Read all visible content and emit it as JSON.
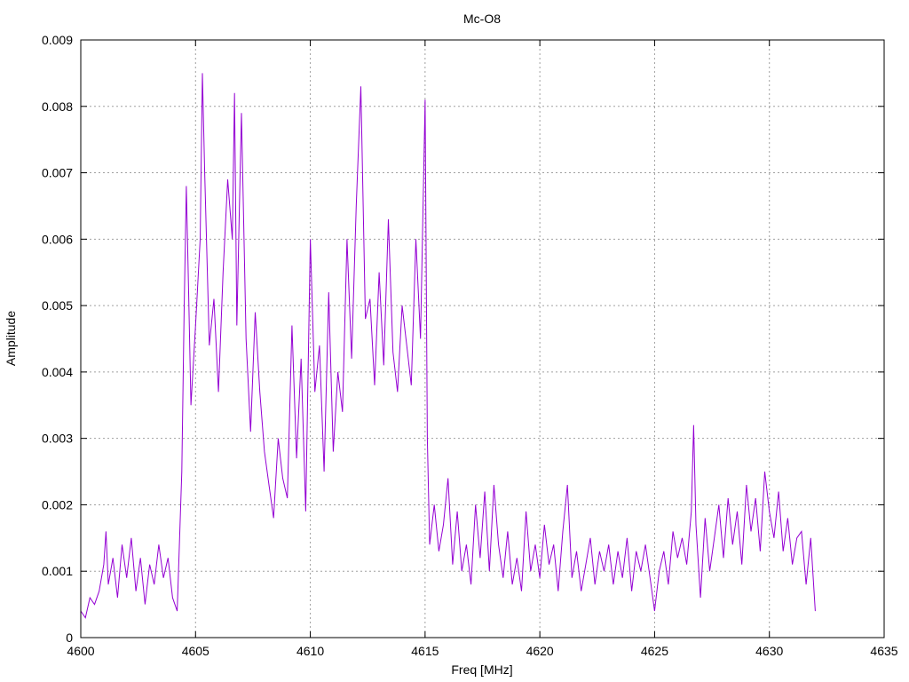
{
  "chart_data": {
    "type": "line",
    "title": "Mc-O8",
    "xlabel": "Freq [MHz]",
    "ylabel": "Amplitude",
    "xlim": [
      4600,
      4635
    ],
    "ylim": [
      0,
      0.009
    ],
    "x_ticks": [
      "4600",
      "4605",
      "4610",
      "4615",
      "4620",
      "4625",
      "4630",
      "4635"
    ],
    "y_ticks": [
      "0",
      "0.001",
      "0.002",
      "0.003",
      "0.004",
      "0.005",
      "0.006",
      "0.007",
      "0.008",
      "0.009"
    ],
    "grid": true,
    "line_color": "#9400d3",
    "series": [
      {
        "x": [
          4600.0,
          4600.2,
          4600.4,
          4600.6,
          4600.8,
          4601.0,
          4601.1,
          4601.2,
          4601.4,
          4601.6,
          4601.8,
          4602.0,
          4602.2,
          4602.4,
          4602.6,
          4602.8,
          4603.0,
          4603.2,
          4603.4,
          4603.6,
          4603.8,
          4604.0,
          4604.2,
          4604.4,
          4604.5,
          4604.6,
          4604.7,
          4604.8,
          4605.0,
          4605.2,
          4605.3,
          4605.4,
          4605.6,
          4605.8,
          4606.0,
          4606.2,
          4606.4,
          4606.6,
          4606.7,
          4606.8,
          4607.0,
          4607.2,
          4607.4,
          4607.6,
          4607.8,
          4608.0,
          4608.2,
          4608.4,
          4608.6,
          4608.8,
          4609.0,
          4609.2,
          4609.4,
          4609.6,
          4609.8,
          4610.0,
          4610.2,
          4610.4,
          4610.6,
          4610.8,
          4611.0,
          4611.2,
          4611.4,
          4611.6,
          4611.8,
          4612.0,
          4612.2,
          4612.4,
          4612.6,
          4612.8,
          4613.0,
          4613.2,
          4613.4,
          4613.6,
          4613.8,
          4614.0,
          4614.2,
          4614.4,
          4614.6,
          4614.8,
          4615.0,
          4615.1,
          4615.2,
          4615.4,
          4615.6,
          4615.8,
          4616.0,
          4616.2,
          4616.4,
          4616.6,
          4616.8,
          4617.0,
          4617.2,
          4617.4,
          4617.6,
          4617.8,
          4618.0,
          4618.2,
          4618.4,
          4618.6,
          4618.8,
          4619.0,
          4619.2,
          4619.4,
          4619.6,
          4619.8,
          4620.0,
          4620.2,
          4620.4,
          4620.6,
          4620.8,
          4621.0,
          4621.2,
          4621.4,
          4621.6,
          4621.8,
          4622.0,
          4622.2,
          4622.4,
          4622.6,
          4622.8,
          4623.0,
          4623.2,
          4623.4,
          4623.6,
          4623.8,
          4624.0,
          4624.2,
          4624.4,
          4624.6,
          4624.8,
          4625.0,
          4625.2,
          4625.4,
          4625.6,
          4625.8,
          4626.0,
          4626.2,
          4626.4,
          4626.6,
          4626.7,
          4626.8,
          4627.0,
          4627.2,
          4627.4,
          4627.6,
          4627.8,
          4628.0,
          4628.2,
          4628.4,
          4628.6,
          4628.8,
          4629.0,
          4629.2,
          4629.4,
          4629.6,
          4629.8,
          4630.0,
          4630.2,
          4630.4,
          4630.6,
          4630.8,
          4631.0,
          4631.2,
          4631.4,
          4631.6,
          4631.8,
          4632.0
        ],
        "y": [
          0.0004,
          0.0003,
          0.0006,
          0.0005,
          0.0007,
          0.0011,
          0.0016,
          0.0008,
          0.0012,
          0.0006,
          0.0014,
          0.0009,
          0.0015,
          0.0007,
          0.0012,
          0.0005,
          0.0011,
          0.0008,
          0.0014,
          0.0009,
          0.0012,
          0.0006,
          0.0004,
          0.0025,
          0.0049,
          0.0068,
          0.0052,
          0.0035,
          0.0047,
          0.006,
          0.0085,
          0.007,
          0.0044,
          0.0051,
          0.0037,
          0.0055,
          0.0069,
          0.006,
          0.0082,
          0.0047,
          0.0079,
          0.0045,
          0.0031,
          0.0049,
          0.0037,
          0.0028,
          0.0023,
          0.0018,
          0.003,
          0.0024,
          0.0021,
          0.0047,
          0.0027,
          0.0042,
          0.0019,
          0.006,
          0.0037,
          0.0044,
          0.0025,
          0.0052,
          0.0028,
          0.004,
          0.0034,
          0.006,
          0.0042,
          0.0065,
          0.0083,
          0.0048,
          0.0051,
          0.0038,
          0.0055,
          0.0041,
          0.0063,
          0.0043,
          0.0037,
          0.005,
          0.0044,
          0.0038,
          0.006,
          0.0045,
          0.0081,
          0.003,
          0.0014,
          0.002,
          0.0013,
          0.0017,
          0.0024,
          0.0011,
          0.0019,
          0.001,
          0.0014,
          0.0008,
          0.002,
          0.0012,
          0.0022,
          0.001,
          0.0023,
          0.0014,
          0.0009,
          0.0016,
          0.0008,
          0.0012,
          0.0007,
          0.0019,
          0.001,
          0.0014,
          0.0009,
          0.0017,
          0.0011,
          0.0014,
          0.0007,
          0.0016,
          0.0023,
          0.0009,
          0.0013,
          0.0007,
          0.0011,
          0.0015,
          0.0008,
          0.0013,
          0.001,
          0.0014,
          0.0008,
          0.0013,
          0.0009,
          0.0015,
          0.0007,
          0.0013,
          0.001,
          0.0014,
          0.0009,
          0.0004,
          0.001,
          0.0013,
          0.0008,
          0.0016,
          0.0012,
          0.0015,
          0.0011,
          0.0019,
          0.0032,
          0.0017,
          0.0006,
          0.0018,
          0.001,
          0.0015,
          0.002,
          0.0012,
          0.0021,
          0.0014,
          0.0019,
          0.0011,
          0.0023,
          0.0016,
          0.0021,
          0.0013,
          0.0025,
          0.0019,
          0.0015,
          0.0022,
          0.0013,
          0.0018,
          0.0011,
          0.0015,
          0.0016,
          0.0008,
          0.0015,
          0.0004
        ]
      }
    ]
  }
}
